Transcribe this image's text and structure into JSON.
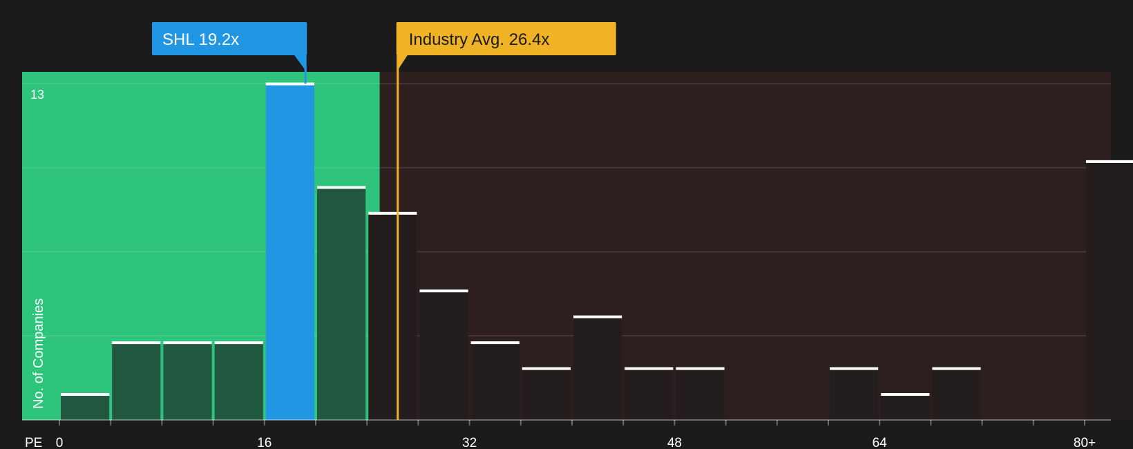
{
  "chart_data": {
    "type": "bar",
    "title": "",
    "xlabel": "PE",
    "ylabel": "No. of Companies",
    "x_tick_labels": [
      {
        "value": 0,
        "label": "0"
      },
      {
        "value": 16,
        "label": "16"
      },
      {
        "value": 32,
        "label": "32"
      },
      {
        "value": 48,
        "label": "48"
      },
      {
        "value": 64,
        "label": "64"
      },
      {
        "value": 80,
        "label": "80+"
      }
    ],
    "y_tick_label": "13",
    "xlim": [
      0,
      82
    ],
    "ylim": [
      0,
      13.5
    ],
    "grid": true,
    "bin_width": 4,
    "bins": [
      {
        "start": 0,
        "value": 1
      },
      {
        "start": 4,
        "value": 3
      },
      {
        "start": 8,
        "value": 3
      },
      {
        "start": 12,
        "value": 3
      },
      {
        "start": 16,
        "value": 13,
        "highlight": true
      },
      {
        "start": 20,
        "value": 9
      },
      {
        "start": 24,
        "value": 8
      },
      {
        "start": 28,
        "value": 5
      },
      {
        "start": 32,
        "value": 3
      },
      {
        "start": 36,
        "value": 2
      },
      {
        "start": 40,
        "value": 4
      },
      {
        "start": 44,
        "value": 2
      },
      {
        "start": 48,
        "value": 2
      },
      {
        "start": 52,
        "value": 0
      },
      {
        "start": 56,
        "value": 0
      },
      {
        "start": 60,
        "value": 2
      },
      {
        "start": 64,
        "value": 1
      },
      {
        "start": 68,
        "value": 2
      },
      {
        "start": 72,
        "value": 0
      },
      {
        "start": 76,
        "value": 0
      },
      {
        "start": 80,
        "value": 10
      }
    ],
    "fair_zone_end": 25,
    "company": {
      "label": "SHL 19.2x",
      "value": 19.2
    },
    "industry_avg": {
      "label": "Industry Avg. 26.4x",
      "value": 26.4
    },
    "colors": {
      "background": "#1b1b1b",
      "fair_zone": "#2ec47c",
      "over_zone": "#2e1f1f",
      "highlight_bar": "#2196e3",
      "industry": "#f0b325",
      "bar_cap": "#ffffff"
    }
  }
}
